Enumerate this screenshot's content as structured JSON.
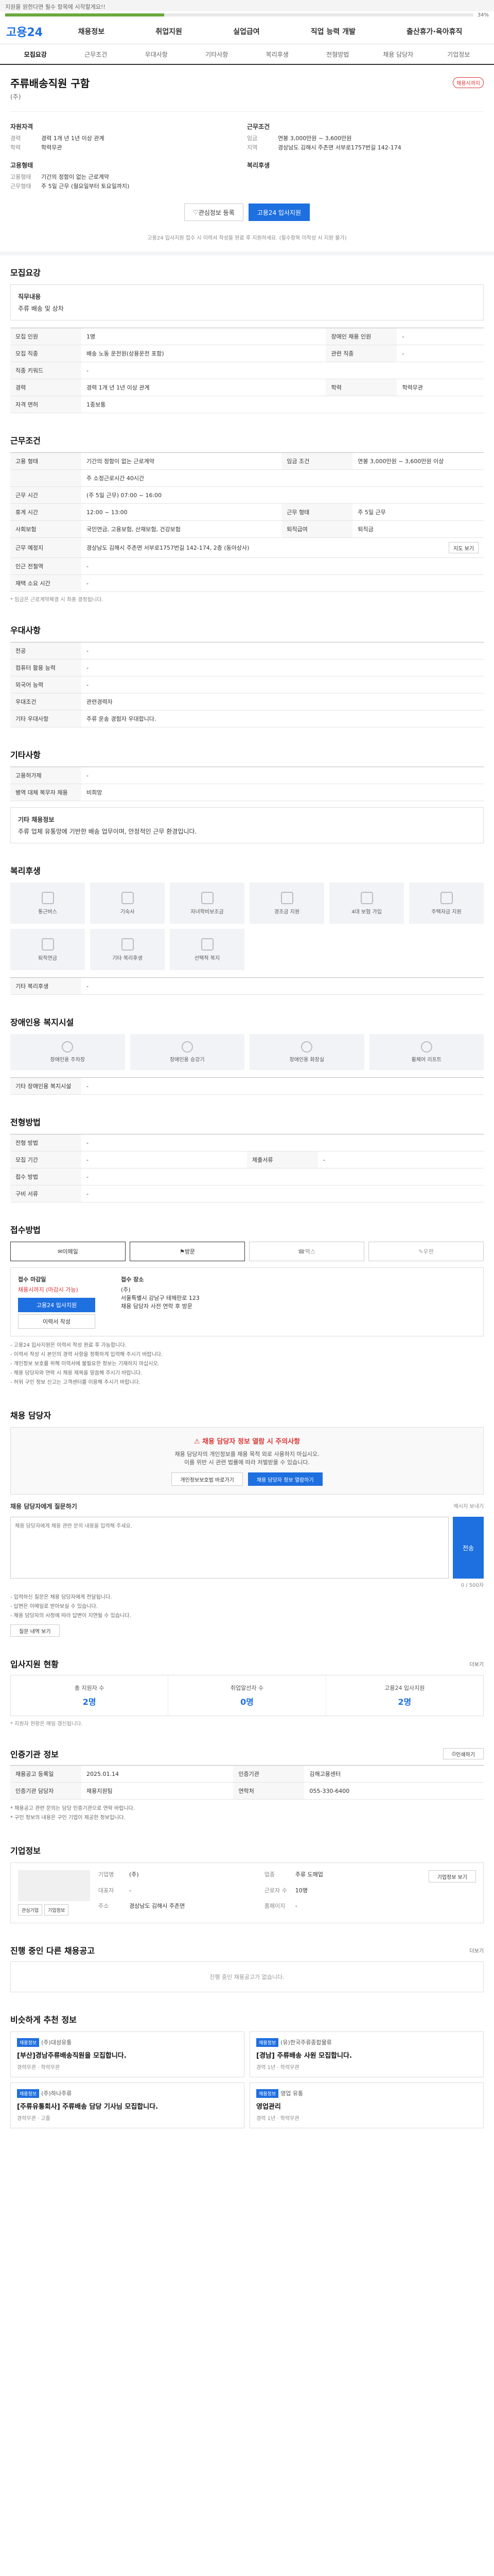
{
  "top_banner": "지원을 원한다면 필수 항목에 시작할게요!!",
  "progress": {
    "percent": 0.34,
    "label": "34%"
  },
  "header": {
    "logo_prefix": "고용",
    "logo_suffix": "24",
    "gnb": [
      "채용정보",
      "취업지원",
      "실업급여",
      "직업 능력 개발",
      "출산휴가·육아휴직"
    ]
  },
  "tabs": [
    "모집요강",
    "근무조건",
    "우대사항",
    "기타사항",
    "복리후생",
    "전형방법",
    "채용 담당자",
    "기업정보"
  ],
  "job": {
    "title": "주류배송직원 구함",
    "badge": "채용시까지",
    "company": "(주)",
    "recruit_title": "자원자격",
    "recruit_rows": [
      {
        "k": "경력",
        "v": "경력 1개 년 1년 이상 관계"
      },
      {
        "k": "학력",
        "v": "학력무관"
      }
    ],
    "work_title": "근무조건",
    "work_rows": [
      {
        "k": "임금",
        "v": "연봉 3,000만원 ~ 3,600만원"
      },
      {
        "k": "지역",
        "v": "경상남도 김해시 주촌면 서부로1757번길 142-174"
      }
    ],
    "type_title": "고용형태",
    "type_rows": [
      {
        "k": "고용형태",
        "v": "기간의 정함이 없는 근로계약"
      },
      {
        "k": "근무형태",
        "v": "주 5일 근무 (월요일부터 토요일까지)"
      }
    ],
    "benefits_title": "복리후생"
  },
  "actions": {
    "interest": "관심정보 등록",
    "apply": "고용24 입사지원",
    "notice": "고용24 입사지원 접수 시 이력서 작성을 완료 후 지원하세요. (필수항목 미작성 시 지원 불가)"
  },
  "recruit": {
    "title": "모집요강",
    "duty_label": "직무내용",
    "duty": "주류 배송 및 상차",
    "rows": [
      {
        "k": "모집 인원",
        "v": "1명",
        "k2": "장애인 채용 인원",
        "v2": "-"
      },
      {
        "k": "모집 직종",
        "v": "배송 노동 운전원(상용운전 포함)",
        "k2": "관련 직종",
        "v2": "-"
      },
      {
        "k": "직종 키워드",
        "v": "-",
        "k2": "",
        "v2": ""
      },
      {
        "k": "경력",
        "v": "경력 1개 년 1년 이상 관계",
        "k2": "학력",
        "v2": "학력무관"
      },
      {
        "k": "자격 면허",
        "v": "1종보통",
        "k2": "",
        "v2": ""
      }
    ]
  },
  "conditions": {
    "title": "근무조건",
    "rows": [
      {
        "k": "고용 형태",
        "v": "기간의 정함이 없는 근로계약",
        "k2": "임금 조건",
        "v2": "연봉 3,000만원 ~ 3,600만원 이상"
      },
      {
        "k": "",
        "v": "주 소정근로시간 40시간",
        "k2": "",
        "v2": ""
      },
      {
        "k": "근무 시간",
        "v": "(주 5일 근무) 07:00 ~ 16:00",
        "k2": "",
        "v2": ""
      },
      {
        "k": "휴게 시간",
        "v": "12:00 ~ 13:00",
        "k2": "근무 형태",
        "v2": "주 5일 근무"
      },
      {
        "k": "사회보험",
        "v": "국민연금, 고용보험, 산재보험, 건강보험",
        "k2": "퇴직급여",
        "v2": "퇴직금"
      },
      {
        "k": "근무 예정지",
        "v": "경상남도 김해시 주촌면 서부로1757번길 142-174, 2층 (동아상사)",
        "k2": "",
        "v2": ""
      },
      {
        "k": "인근 전철역",
        "v": "-",
        "k2": "",
        "v2": ""
      },
      {
        "k": "재택 소요 시간",
        "v": "-",
        "k2": "",
        "v2": ""
      }
    ],
    "note": "* 임금은 근로계약체결 시 최종 결정됩니다.",
    "map_button": "지도 보기"
  },
  "preference": {
    "title": "우대사항",
    "rows": [
      {
        "k": "전공",
        "v": "-"
      },
      {
        "k": "컴퓨터 활용 능력",
        "v": "-"
      },
      {
        "k": "외국어 능력",
        "v": "-"
      },
      {
        "k": "우대조건",
        "v": "관련경력자"
      },
      {
        "k": "기타 우대사항",
        "v": "주류 운송 경험자 우대합니다."
      }
    ]
  },
  "etc": {
    "title": "기타사항",
    "rows": [
      {
        "k": "고용허가제",
        "v": "-"
      },
      {
        "k": "병역 대체 복무자 채용",
        "v": "비희망"
      }
    ],
    "extra_label": "기타 채용정보",
    "extra": "주류 업체 유통망에 기반한 배송 업무이며, 안정적인 근무 환경입니다."
  },
  "welfare": {
    "title": "복리후생",
    "items": [
      "통근버스",
      "기숙사",
      "자녀학비보조금",
      "경조금 지원",
      "4대 보험 가입",
      "주택자금 지원",
      "퇴직연금",
      "기타 복리후생",
      "선택적 복지",
      ""
    ],
    "other_label": "기타 복리후생",
    "other": "-"
  },
  "accessibility": {
    "title": "장애인용 복지시설",
    "items": [
      "장애인용 주차장",
      "장애인용 승강기",
      "장애인용 화장실",
      "휠체어 리프트"
    ],
    "other_label": "기타 장애인용 복지시설",
    "other": "-"
  },
  "screening": {
    "title": "전형방법",
    "rows": [
      {
        "k": "전형 방법",
        "v": "-",
        "k2": "",
        "v2": ""
      },
      {
        "k": "모집 기간",
        "v": "-",
        "k2": "제출서류",
        "v2": "-"
      },
      {
        "k": "접수 방법",
        "v": "-",
        "k2": "",
        "v2": ""
      },
      {
        "k": "구비 서류",
        "v": "-",
        "k2": "",
        "v2": ""
      }
    ]
  },
  "apply_method": {
    "title": "접수방법",
    "methods": [
      "이메일",
      "방문",
      "팩스",
      "우편"
    ],
    "deadline_label": "접수 마감일",
    "deadline": "채용시까지 (마감시 가능)",
    "apply_button": "고용24 입사지원",
    "resume_button": "이력서 작성",
    "place_label": "접수 장소",
    "place_name": "(주)",
    "place_address": "서울특별시 강남구 테헤란로 123",
    "contact": "채용 담당자 사전 연락 후 방문",
    "bullets": [
      "- 고용24 입사지원은 이력서 작성 완료 후 가능합니다.",
      "- 이력서 작성 시 본인의 경력 사항을 정확하게 입력해 주시기 바랍니다.",
      "- 개인정보 보호를 위해 이력서에 불필요한 정보는 기재하지 마십시오.",
      "- 채용 담당자와 연락 시 채용 제목을 말씀해 주시기 바랍니다.",
      "- 허위 구인 정보 신고는 고객센터를 이용해 주시기 바랍니다."
    ]
  },
  "contact": {
    "title": "채용 담당자",
    "warning_title": "채용 담당자 정보 열람 시 주의사항",
    "warning_text": "채용 담당자의 개인정보를 채용 목적 외로 사용하지 마십시오.",
    "warning_sub": "이를 위반 시 관련 법률에 따라 처벌받을 수 있습니다.",
    "btn_privacy": "개인정보보호법 바로가기",
    "btn_view": "채용 담당자 정보 열람하기",
    "message_label": "채용 담당자에게 질문하기",
    "message_sub": "메시지 보내기",
    "message_placeholder": "채용 담당자에게 채용 관련 문의 내용을 입력해 주세요.",
    "message_count": "0 / 500자",
    "send": "전송",
    "notes": [
      "- 입력하신 질문은 채용 담당자에게 전달됩니다.",
      "- 답변은 이메일로 받아보실 수 있습니다.",
      "- 채용 담당자의 사정에 따라 답변이 지연될 수 있습니다."
    ],
    "history_button": "질문 내역 보기"
  },
  "applicants": {
    "title": "입사지원 현황",
    "more": "더보기",
    "stats": [
      {
        "label": "총 지원자 수",
        "value": "2명"
      },
      {
        "label": "취업알선자 수",
        "value": "0명"
      },
      {
        "label": "고용24 입사지원",
        "value": "2명"
      }
    ],
    "note": "* 지원자 현황은 매일 갱신됩니다."
  },
  "recruiter": {
    "title": "인증기관 정보",
    "rows": [
      {
        "k": "채용공고 등록일",
        "v": "2025.01.14",
        "k2": "인증기관",
        "v2": "김해고용센터"
      },
      {
        "k": "인증기관 담당자",
        "v": "채용지원팀",
        "k2": "연락처",
        "v2": "055-330-6400"
      }
    ],
    "notes": [
      "* 채용공고 관련 문의는 담당 인증기관으로 연락 바랍니다.",
      "* 구인 정보의 내용은 구인 기업이 제공한 정보입니다."
    ],
    "print_button": "인쇄하기"
  },
  "company_info": {
    "title": "기업정보",
    "detail_button": "기업정보 보기",
    "fields": [
      {
        "k": "기업명",
        "v": "(주)"
      },
      {
        "k": "업종",
        "v": "주류 도매업"
      },
      {
        "k": "대표자",
        "v": "-"
      },
      {
        "k": "근로자 수",
        "v": "10명"
      },
      {
        "k": "주소",
        "v": "경상남도 김해시 주촌면"
      },
      {
        "k": "홈페이지",
        "v": "-"
      }
    ],
    "actions": [
      "관심기업",
      "기업정보"
    ]
  },
  "other_jobs": {
    "title": "진행 중인 다른 채용공고",
    "more": "더보기",
    "empty": "진행 중인 채용공고가 없습니다."
  },
  "recommended": {
    "title": "비슷하게 추천 정보",
    "cards": [
      {
        "tag": "채용정보",
        "company": "(주)대성유통",
        "title": "[부산]경남주류배송직원을 모집합니다.",
        "meta": "경력무관 · 학력무관"
      },
      {
        "tag": "채용정보",
        "company": "(유)한국주류종합물류",
        "title": "[경남] 주류배송 사원 모집합니다.",
        "meta": "경력 1년 · 학력무관"
      },
      {
        "tag": "채용정보",
        "company": "(주)하나주류",
        "title": "[주류유통회사] 주류배송 담당 기사님 모집합니다.",
        "meta": "경력무관 · 고졸"
      },
      {
        "tag": "채용정보",
        "company": "영업 유통",
        "title": "영업관리",
        "meta": "경력 1년 · 학력무관"
      }
    ]
  }
}
